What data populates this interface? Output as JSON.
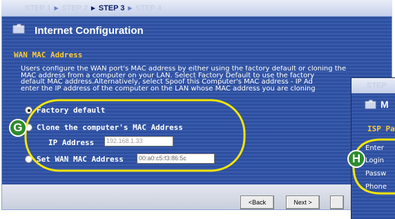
{
  "steps": {
    "items": [
      "STEP 1",
      "STEP 2",
      "STEP 3",
      "STEP 4"
    ],
    "current_index": 2,
    "separator": "▸"
  },
  "header": {
    "title": "Internet Configuration",
    "icon": "folder-icon"
  },
  "section": {
    "title": "WAN MAC Address"
  },
  "description": {
    "lines": [
      "Users configure the WAN port's MAC address by either using the factory default or cloning the",
      "MAC address from a computer on your LAN. Select Factory Default to use the factory",
      "default MAC address.Alternatively, select Spoof this Computer's MAC address - IP Ad",
      "enter the IP address of the computer on the LAN whose MAC address you are cloning"
    ]
  },
  "options": {
    "factory_default": {
      "label": "Factory default",
      "selected": true
    },
    "clone": {
      "label": "Clone the computer's MAC Address",
      "selected": false
    },
    "ip_address_label": "IP Address",
    "ip_address_value": "192.168.1.33",
    "set_wan": {
      "label": "Set WAN MAC Address",
      "selected": false
    },
    "mac_value": "00:a0:c5:f3:86:5c"
  },
  "buttons": {
    "back": "<Back",
    "next": "Next >"
  },
  "second_panel": {
    "steps_label": "STEP",
    "header": "M",
    "section": "ISP Pa",
    "rows": [
      "Enter",
      "Login",
      "Passw",
      "Phone"
    ]
  },
  "callouts": {
    "g": "G",
    "h": "H"
  },
  "colors": {
    "panel_blue": "#2e4f9f",
    "section_yellow": "#ffcc33",
    "callout_yellow": "#f6e600",
    "callout_badge": "#2e8b2e"
  }
}
